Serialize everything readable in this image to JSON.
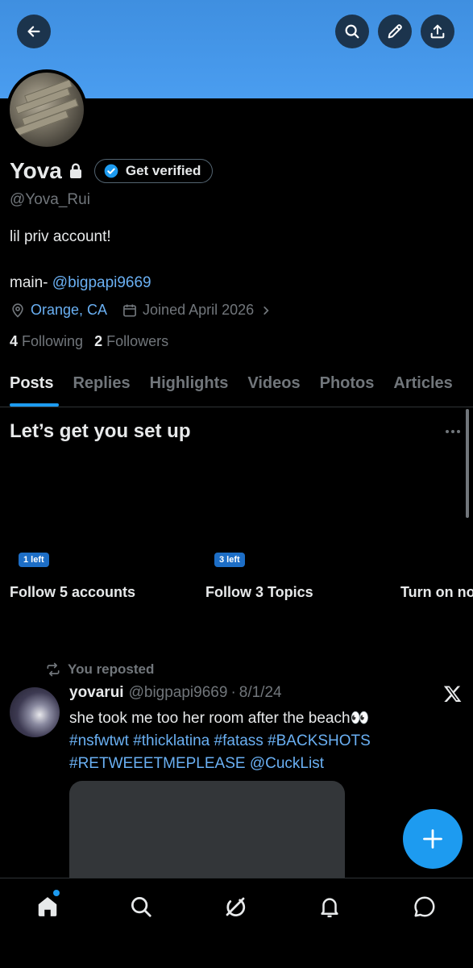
{
  "header": {
    "icons": [
      "back-arrow-icon",
      "search-icon",
      "edit-pencil-icon",
      "share-icon"
    ]
  },
  "profile": {
    "name": "Yova",
    "verify_label": "Get verified",
    "handle": "@Yova_Rui",
    "bio_line1": "lil priv account!",
    "bio_prefix": "main- ",
    "bio_mention": "@bigpapi9669",
    "location": "Orange, CA",
    "joined": "Joined April 2026",
    "following_count": "4",
    "following_label": "Following",
    "followers_count": "2",
    "followers_label": "Followers"
  },
  "tabs": [
    "Posts",
    "Replies",
    "Highlights",
    "Videos",
    "Photos",
    "Articles"
  ],
  "setup": {
    "title": "Let’s get you set up",
    "cards": [
      {
        "badge": "1 left",
        "title": "Follow 5 accounts"
      },
      {
        "badge": "3 left",
        "title": "Follow 3 Topics"
      },
      {
        "badge": "",
        "title": "Turn on no"
      }
    ]
  },
  "post": {
    "repost_label": "You reposted",
    "username": "yovarui",
    "handle": "@bigpapi9669",
    "separator": "·",
    "date": "8/1/24",
    "text": "she took me too her room after the beach👀",
    "tags_line1": "#nsfwtwt #thicklatina #fatass #BACKSHOTS",
    "tags_line2": "#RETWEEETMEPLEASE @CuckList"
  },
  "colors": {
    "accent": "#1d9bf0",
    "link": "#6ab0f3",
    "banner": "#4a9df0",
    "muted": "#71767b"
  },
  "bottom_nav": [
    "home-icon",
    "search-icon",
    "grok-icon",
    "notifications-icon",
    "messages-icon"
  ]
}
